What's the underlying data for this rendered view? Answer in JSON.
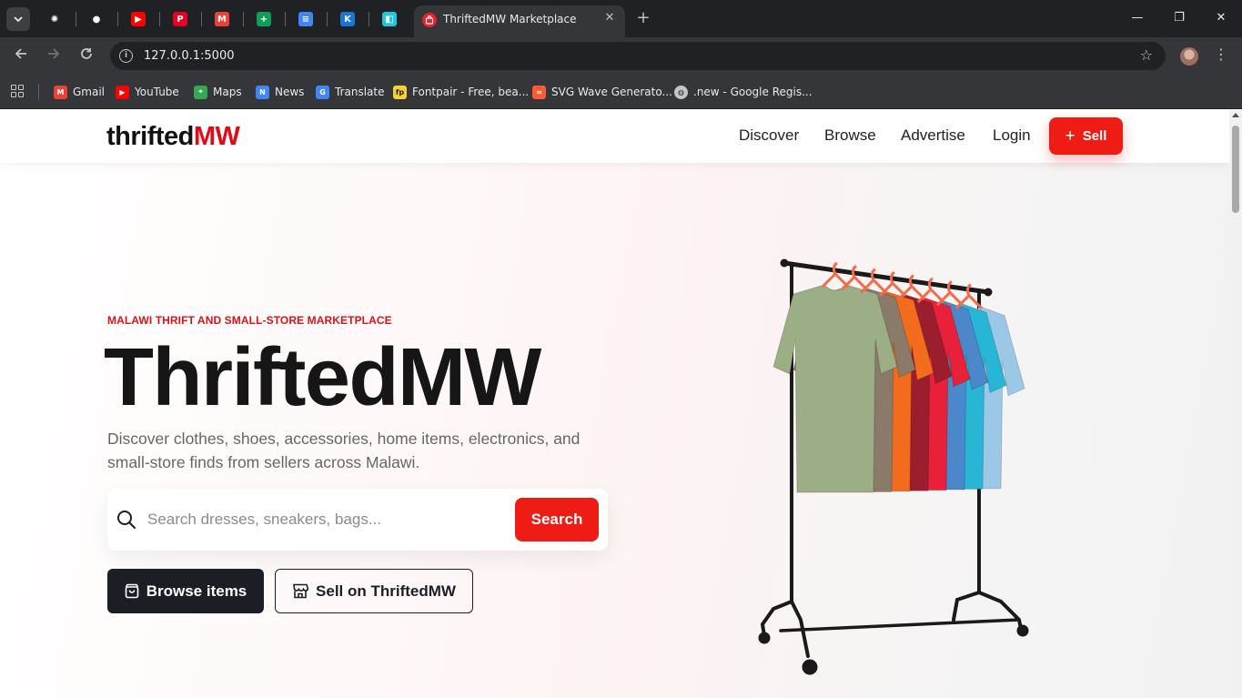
{
  "browser": {
    "tab": {
      "title": "ThriftedMW Marketplace",
      "close": "✕"
    },
    "new_tab": "+",
    "window_controls": {
      "minimize": "—",
      "restore": "❐",
      "close": "✕"
    },
    "url": "127.0.0.1:5000",
    "pinned_tabs": [
      {
        "icon": "openai-icon",
        "color": "#ffffff"
      },
      {
        "icon": "github-icon",
        "color": "#ffffff"
      },
      {
        "icon": "youtube-icon",
        "color": "#ff0000"
      },
      {
        "icon": "pinterest-icon",
        "color": "#e60023"
      },
      {
        "icon": "gmail-icon",
        "color": "#ea4335"
      },
      {
        "icon": "google-sheets-icon",
        "color": "#0f9d58"
      },
      {
        "icon": "google-docs-icon",
        "color": "#4285f4"
      },
      {
        "icon": "kotlin-icon",
        "color": "#1976d2"
      },
      {
        "icon": "app-icon",
        "color": "#26c6da"
      }
    ],
    "bookmarks": [
      {
        "label": "Gmail",
        "icon": "gmail-icon",
        "color": "#ea4335"
      },
      {
        "label": "YouTube",
        "icon": "youtube-icon",
        "color": "#ff0000"
      },
      {
        "label": "Maps",
        "icon": "maps-icon",
        "color": "#34a853"
      },
      {
        "label": "News",
        "icon": "news-icon",
        "color": "#4285f4"
      },
      {
        "label": "Translate",
        "icon": "translate-icon",
        "color": "#4285f4"
      },
      {
        "label": "Fontpair - Free, bea...",
        "icon": "fontpair-icon",
        "color": "#f7d033"
      },
      {
        "label": "SVG Wave Generato...",
        "icon": "svgwave-icon",
        "color": "#ff5a36"
      },
      {
        "label": ".new - Google Regis...",
        "icon": "globe-icon",
        "color": "#c4c7c5"
      }
    ]
  },
  "site": {
    "logo": {
      "part1": "thrifted",
      "part2": "MW"
    },
    "nav": [
      "Discover",
      "Browse",
      "Advertise",
      "Login"
    ],
    "sell_label": "Sell",
    "accent": "#ee1c14"
  },
  "hero": {
    "eyebrow": "MALAWI THRIFT AND SMALL-STORE MARKETPLACE",
    "title": "ThriftedMW",
    "description": "Discover clothes, shoes, accessories, home items, electronics, and small-store finds from sellers across Malawi.",
    "search": {
      "placeholder": "Search dresses, sneakers, bags...",
      "value": "",
      "button": "Search"
    },
    "buttons": {
      "browse": "Browse items",
      "sell": "Sell on ThriftedMW"
    },
    "shirt_colors": [
      "#9cae85",
      "#8a7a6a",
      "#f36b1c",
      "#9a1e2e",
      "#e8203a",
      "#4a88c9",
      "#29b6d6",
      "#9cc8e8"
    ]
  }
}
